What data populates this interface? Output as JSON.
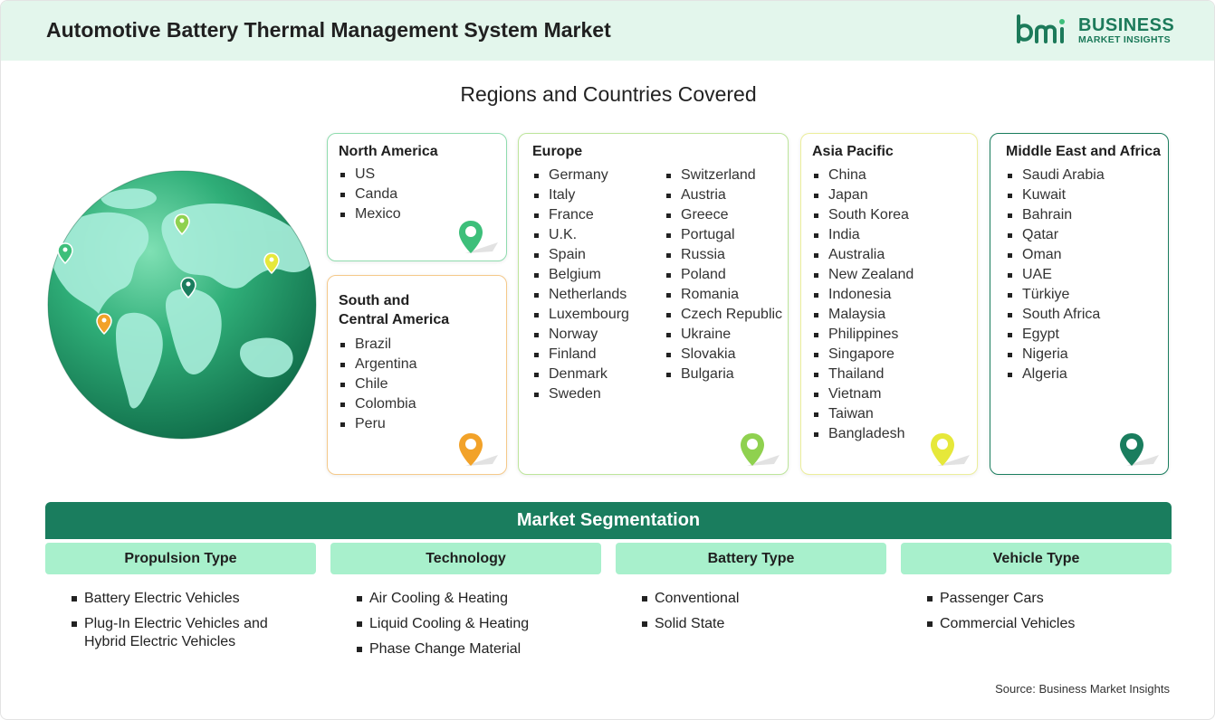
{
  "header": {
    "title": "Automotive Battery Thermal Management System Market"
  },
  "logo": {
    "line1": "BUSINESS",
    "line2": "MARKET INSIGHTS",
    "color": "#1c7a5a"
  },
  "regions": {
    "title": "Regions and Countries Covered",
    "north_america": {
      "title": "North America",
      "items": [
        "US",
        "Canda",
        "Mexico"
      ]
    },
    "south_america": {
      "title_line1": "South and",
      "title_line2": "Central America",
      "items": [
        "Brazil",
        "Argentina",
        "Chile",
        "Colombia",
        "Peru"
      ]
    },
    "europe": {
      "title": "Europe",
      "col1": [
        "Germany",
        "Italy",
        "France",
        "U.K.",
        "Spain",
        "Belgium",
        "Netherlands",
        "Luxembourg",
        "Norway",
        "Finland",
        "Denmark",
        "Sweden"
      ],
      "col2": [
        "Switzerland",
        "Austria",
        "Greece",
        "Portugal",
        "Russia",
        "Poland",
        "Romania",
        "Czech Republic",
        "Ukraine",
        "Slovakia",
        "Bulgaria"
      ]
    },
    "asia_pacific": {
      "title": "Asia Pacific",
      "items": [
        "China",
        "Japan",
        "South Korea",
        "India",
        "Australia",
        "New Zealand",
        "Indonesia",
        "Malaysia",
        "Philippines",
        "Singapore",
        "Thailand",
        "Vietnam",
        "Taiwan",
        "Bangladesh"
      ]
    },
    "mea": {
      "title": "Middle East and Africa",
      "items": [
        "Saudi Arabia",
        "Kuwait",
        "Bahrain",
        "Qatar",
        "Oman",
        "UAE",
        "Türkiye",
        "South Africa",
        "Egypt",
        "Nigeria",
        "Algeria"
      ]
    }
  },
  "colors": {
    "north_america": "#3dbf7a",
    "south_america": "#f2a229",
    "europe": "#8fd14f",
    "asia_pacific": "#e6e83a",
    "mea": "#1a7d5e"
  },
  "segmentation": {
    "title": "Market Segmentation",
    "columns": [
      {
        "title": "Propulsion Type",
        "items": [
          "Battery Electric Vehicles",
          "Plug-In Electric Vehicles and Hybrid Electric Vehicles"
        ]
      },
      {
        "title": "Technology",
        "items": [
          "Air Cooling & Heating",
          "Liquid Cooling & Heating",
          "Phase Change Material"
        ]
      },
      {
        "title": "Battery Type",
        "items": [
          "Conventional",
          "Solid State"
        ]
      },
      {
        "title": "Vehicle Type",
        "items": [
          "Passenger Cars",
          "Commercial Vehicles"
        ]
      }
    ]
  },
  "source": "Source: Business Market Insights"
}
